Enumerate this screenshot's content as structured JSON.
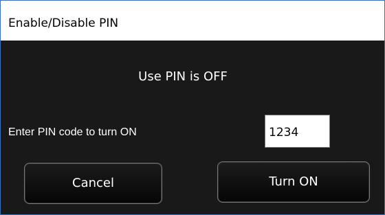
{
  "window": {
    "title": "Enable/Disable PIN"
  },
  "content": {
    "status": "Use PIN is OFF",
    "prompt_label": "Enter PIN code to turn ON",
    "pin_value": "1234",
    "cancel_label": "Cancel",
    "turn_on_label": "Turn ON"
  },
  "colors": {
    "background": "#191919",
    "text": "#ffffff",
    "window_border": "#3c6fb6"
  }
}
